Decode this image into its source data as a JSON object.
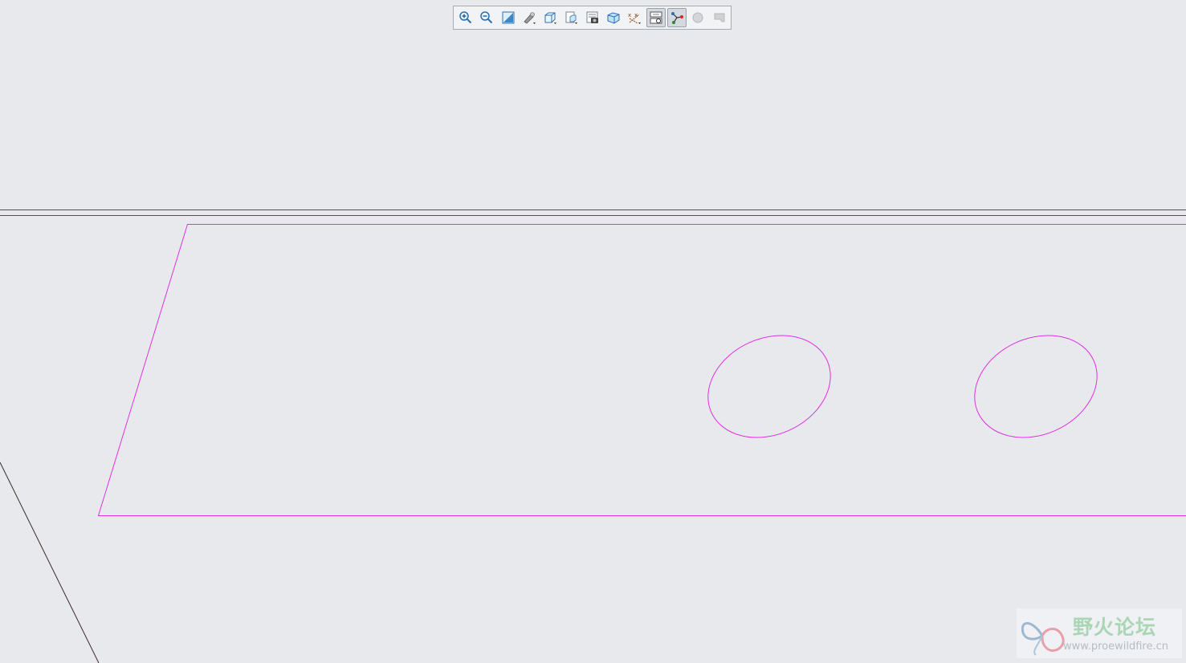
{
  "window": {
    "background": "#e8e9ed"
  },
  "toolbar": {
    "items": [
      {
        "name": "zoom-in-button",
        "icon": "zoom-in-icon",
        "active": false
      },
      {
        "name": "zoom-out-button",
        "icon": "zoom-out-icon",
        "active": false
      },
      {
        "name": "refit-button",
        "icon": "refit-icon",
        "active": false
      },
      {
        "name": "repaint-button",
        "icon": "repaint-icon",
        "active": false
      },
      {
        "name": "display-style-button",
        "icon": "display-style-cube-icon",
        "active": false
      },
      {
        "name": "saved-orientations-button",
        "icon": "saved-views-icon",
        "active": false
      },
      {
        "name": "view-manager-button",
        "icon": "view-manager-icon",
        "active": false
      },
      {
        "name": "perspective-view-button",
        "icon": "perspective-view-icon",
        "active": false
      },
      {
        "name": "datum-display-button",
        "icon": "datum-display-icon",
        "active": false
      },
      {
        "name": "sketch-view-button",
        "icon": "sketch-view-icon",
        "active": true
      },
      {
        "name": "sketcher-display-button",
        "icon": "sketcher-display-icon",
        "active": true
      },
      {
        "name": "disabled-sphere-button",
        "icon": "sphere-icon",
        "active": false
      },
      {
        "name": "disabled-flag-button",
        "icon": "flag-icon",
        "active": false
      }
    ]
  },
  "colors": {
    "sketch_entity": "#e030e0",
    "datum_line": "#3a2a2a"
  },
  "watermark": {
    "title": "野火论坛",
    "url": "www.proewildfire.cn",
    "logo": "butterfly-logo-icon"
  }
}
